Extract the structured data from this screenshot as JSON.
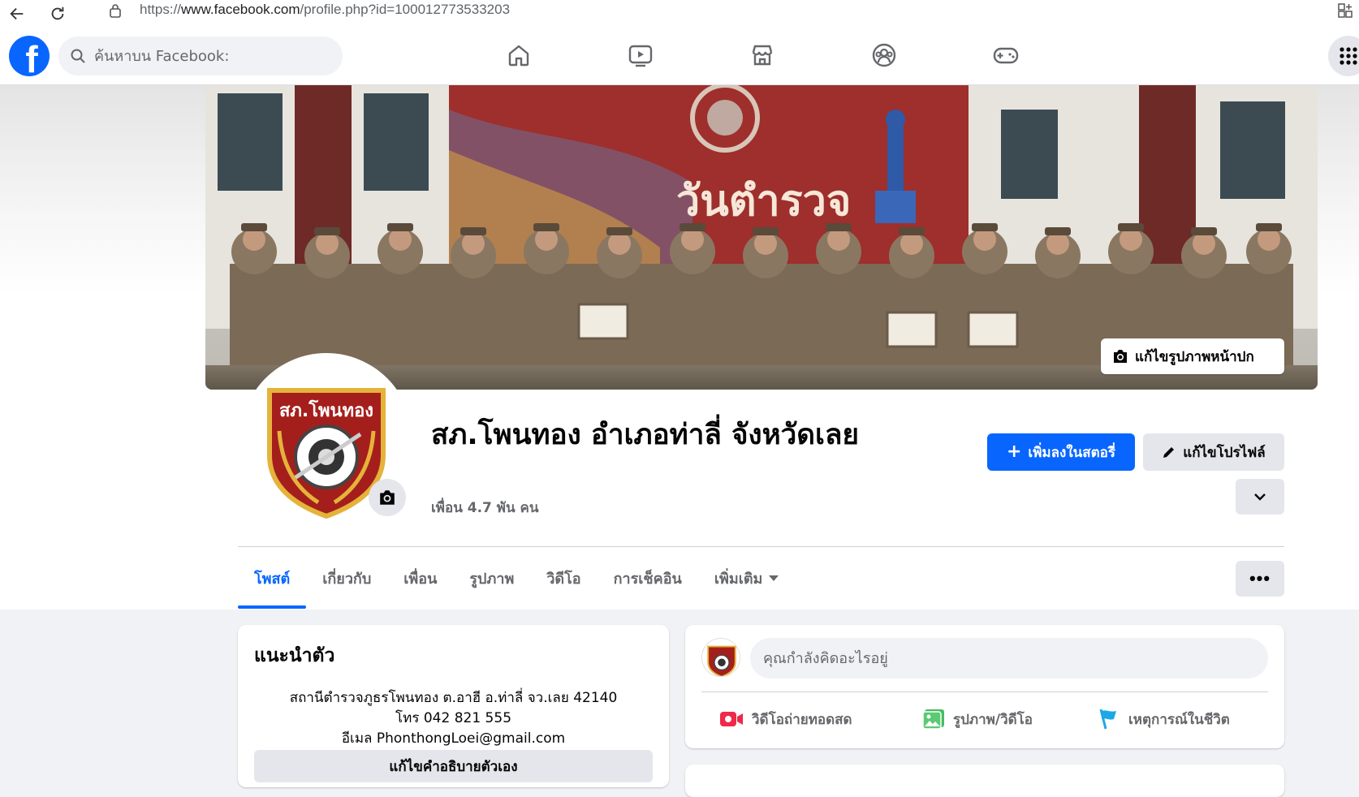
{
  "browser": {
    "url_prefix": "https://",
    "url_domain": "www.facebook.com",
    "url_path": "/profile.php?id=100012773533203"
  },
  "header": {
    "logo_letter": "f",
    "search_placeholder": "ค้นหาบน Facebook:",
    "nav_icons": [
      "home-icon",
      "video-icon",
      "marketplace-icon",
      "groups-icon",
      "gaming-icon"
    ]
  },
  "cover": {
    "banner_text": "วันตำรวจ",
    "edit_cover_label": "แก้ไขรูปภาพหน้าปก"
  },
  "profile": {
    "name": "สภ.โพนทอง อำเภอท่าลี่ จังหวัดเลย",
    "friends": "เพื่อน 4.7 พัน คน",
    "badge_text": "สภ.โพนทอง",
    "add_story_label": "เพิ่มลงในสตอรี่",
    "edit_profile_label": "แก้ไขโปรไฟล์"
  },
  "tabs": [
    {
      "label": "โพสต์",
      "active": true
    },
    {
      "label": "เกี่ยวกับ",
      "active": false
    },
    {
      "label": "เพื่อน",
      "active": false
    },
    {
      "label": "รูปภาพ",
      "active": false
    },
    {
      "label": "วิดีโอ",
      "active": false
    },
    {
      "label": "การเช็คอิน",
      "active": false
    },
    {
      "label": "เพิ่มเติม",
      "active": false
    }
  ],
  "intro": {
    "title": "แนะนำตัว",
    "address": "สถานีตำรวจภูธรโพนทอง ต.อาฮี อ.ท่าลี่ จว.เลย 42140",
    "phone": "โทร 042 821 555",
    "email": "อีเมล PhonthongLoei@gmail.com",
    "edit_bio_label": "แก้ไขคำอธิบายตัวเอง"
  },
  "composer": {
    "placeholder": "คุณกำลังคิดอะไรอยู่",
    "actions": [
      {
        "label": "วิดีโอถ่ายทอดสด",
        "icon": "live-video-icon",
        "color": "#f02849"
      },
      {
        "label": "รูปภาพ/วิดีโอ",
        "icon": "photo-icon",
        "color": "#45bd62"
      },
      {
        "label": "เหตุการณ์ในชีวิต",
        "icon": "flag-icon",
        "color": "#1ba8e7"
      }
    ]
  },
  "colors": {
    "primary": "#0866ff",
    "secondary_bg": "#e4e6eb",
    "text_muted": "#65676b"
  }
}
